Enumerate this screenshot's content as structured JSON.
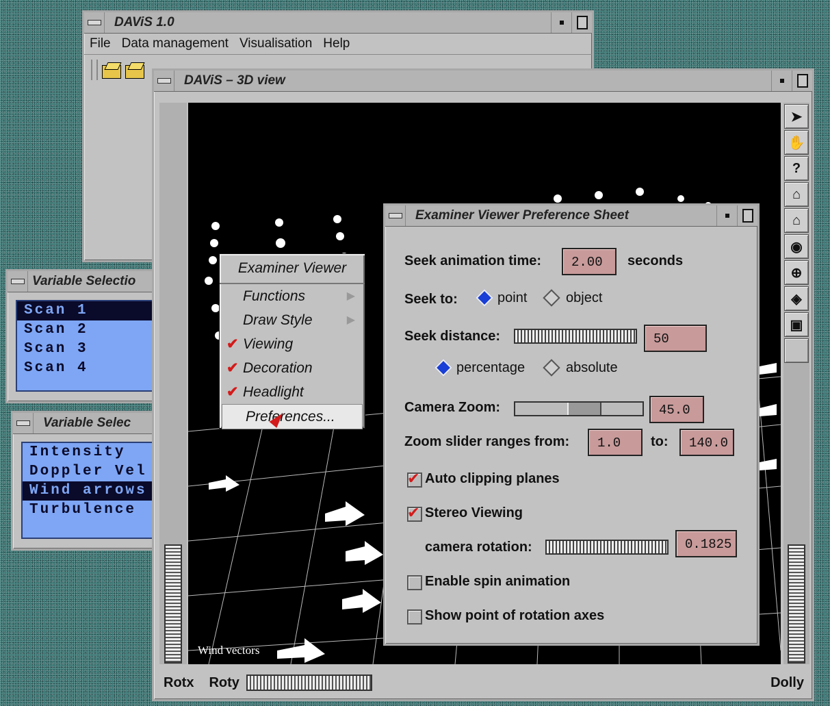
{
  "main_window": {
    "title": "DAViS 1.0",
    "menu": [
      "File",
      "Data management",
      "Visualisation",
      "Help"
    ]
  },
  "var_window_1": {
    "title": "Variable Selectio",
    "items": [
      "Scan 1",
      "Scan 2",
      "Scan 3",
      "Scan 4"
    ],
    "selected": "Scan 1"
  },
  "var_window_2": {
    "title": "Variable Selec",
    "items": [
      "Intensity",
      "Doppler Vel",
      "Wind arrows",
      "Turbulence"
    ],
    "selected": "Wind arrows"
  },
  "view3d": {
    "title": "DAViS – 3D view",
    "overlay_label": "Wind vectors",
    "bottom": {
      "rotx": "Rotx",
      "roty": "Roty",
      "dolly": "Dolly"
    },
    "toolbar": [
      "arrow-icon",
      "hand-icon",
      "help-icon",
      "home-icon",
      "set-home-icon",
      "view-all-icon",
      "seek-icon",
      "perspective-icon",
      "camera-icon"
    ],
    "toolbar_glyphs": [
      "➤",
      "✋",
      "?",
      "⌂",
      "⌂",
      "◉",
      "⊕",
      "◈",
      "▣"
    ]
  },
  "popup_menu": {
    "header": "Examiner Viewer",
    "items": [
      {
        "label": "Functions",
        "submenu": true,
        "checked": false
      },
      {
        "label": "Draw Style",
        "submenu": true,
        "checked": false
      },
      {
        "label": "Viewing",
        "submenu": false,
        "checked": true
      },
      {
        "label": "Decoration",
        "submenu": false,
        "checked": true
      },
      {
        "label": "Headlight",
        "submenu": false,
        "checked": true
      },
      {
        "label": "Preferences...",
        "submenu": false,
        "checked": false,
        "highlighted": true
      }
    ]
  },
  "pref_sheet": {
    "title": "Examiner Viewer Preference Sheet",
    "seek_animation_label": "Seek animation time:",
    "seek_animation_value": "2.00",
    "seek_animation_unit": "seconds",
    "seek_to_label": "Seek to:",
    "seek_to_options": [
      "point",
      "object"
    ],
    "seek_to_selected": "point",
    "seek_distance_label": "Seek distance:",
    "seek_distance_value": "50",
    "distance_mode_options": [
      "percentage",
      "absolute"
    ],
    "distance_mode_selected": "percentage",
    "camera_zoom_label": "Camera Zoom:",
    "camera_zoom_value": "45.0",
    "zoom_range_label": "Zoom slider ranges from:",
    "zoom_range_from": "1.0",
    "zoom_range_to_label": "to:",
    "zoom_range_to": "140.0",
    "auto_clipping_label": "Auto clipping planes",
    "auto_clipping_checked": true,
    "stereo_label": "Stereo Viewing",
    "stereo_checked": true,
    "camera_rotation_label": "camera rotation:",
    "camera_rotation_value": "0.1825",
    "spin_label": "Enable spin animation",
    "spin_checked": false,
    "axes_label": "Show point of rotation axes",
    "axes_checked": false
  },
  "colors": {
    "desktop": "#3f7a78",
    "list_bg": "#7ea6f4",
    "field_bg": "#c89a9a",
    "check": "#d41a1a"
  }
}
